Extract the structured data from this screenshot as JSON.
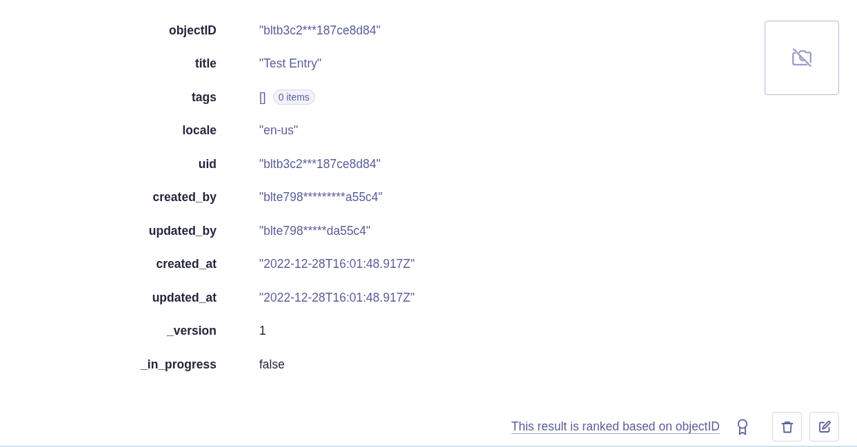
{
  "record": {
    "fields": [
      {
        "name": "objectID",
        "kind": "string",
        "value": "\"bltb3c2***187ce8d84\""
      },
      {
        "name": "title",
        "kind": "string",
        "value": "\"Test Entry\""
      },
      {
        "name": "tags",
        "kind": "array",
        "value": "[]",
        "badge": "0 items"
      },
      {
        "name": "locale",
        "kind": "string",
        "value": "\"en-us\""
      },
      {
        "name": "uid",
        "kind": "string",
        "value": "\"bltb3c2***187ce8d84\""
      },
      {
        "name": "created_by",
        "kind": "string",
        "value": "\"blte798*********a55c4\""
      },
      {
        "name": "updated_by",
        "kind": "string",
        "value": "\"blte798*****da55c4\""
      },
      {
        "name": "created_at",
        "kind": "string",
        "value": "\"2022-12-28T16:01:48.917Z\""
      },
      {
        "name": "updated_at",
        "kind": "string",
        "value": "\"2022-12-28T16:01:48.917Z\""
      },
      {
        "name": "_version",
        "kind": "number",
        "value": "1"
      },
      {
        "name": "_in_progress",
        "kind": "boolean",
        "value": "false"
      }
    ]
  },
  "footer": {
    "ranking_link": "This result is ranked based on objectID"
  }
}
